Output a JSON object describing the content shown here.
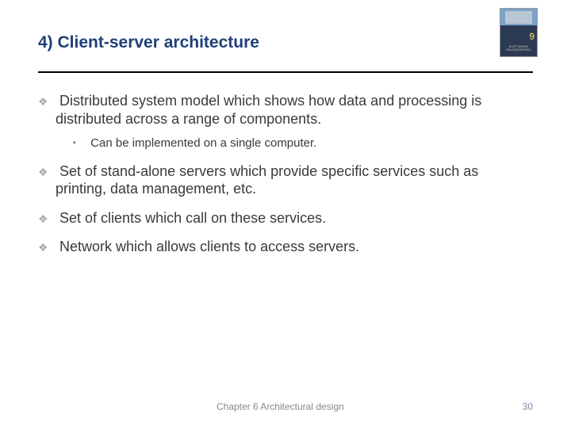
{
  "header": {
    "title": "4) Client-server architecture",
    "book_edition": "9",
    "book_label": "SOFTWARE ENGINEERING"
  },
  "bullets": [
    {
      "text": "Distributed system model which shows how data and processing is distributed across a range of components.",
      "sub": [
        "Can be implemented on a single computer."
      ]
    },
    {
      "text": "Set of stand-alone servers which provide specific services such as printing, data management, etc."
    },
    {
      "text": "Set of clients which call on these services."
    },
    {
      "text": "Network which allows clients to access servers."
    }
  ],
  "footer": {
    "chapter": "Chapter 6 Architectural design",
    "page": "30"
  }
}
